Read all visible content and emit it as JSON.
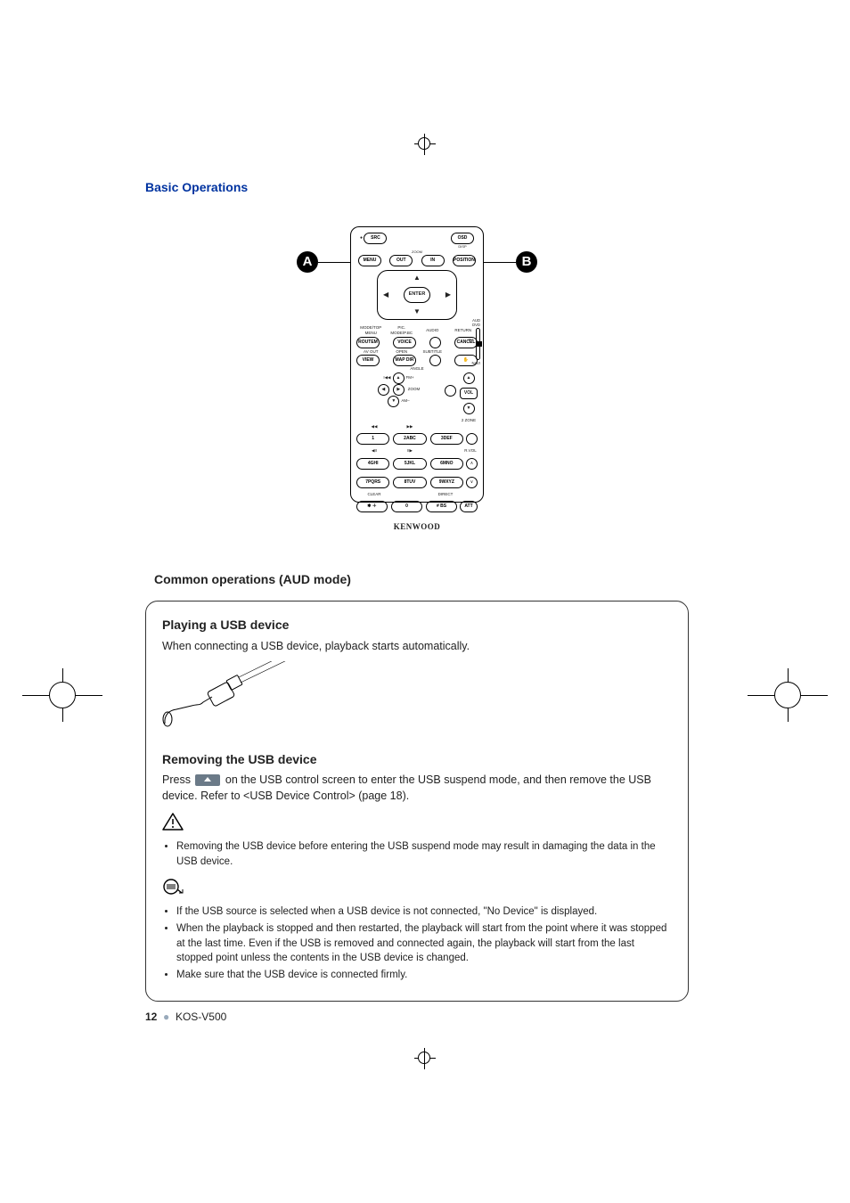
{
  "page": {
    "section_title": "Basic Operations",
    "subhead": "Common operations (AUD mode)",
    "page_number": "12",
    "model": "KOS-V500"
  },
  "callouts": {
    "A": "A",
    "B": "B"
  },
  "remote": {
    "top_labels": {
      "disp": "DISP",
      "ii_skip": "▶II"
    },
    "top_buttons": {
      "src": "SRC",
      "osd": "OSD"
    },
    "zoom_row_label": "ZOOM",
    "zoom_row": {
      "menu": "MENU",
      "out": "OUT",
      "in": "IN",
      "position": "POSITION"
    },
    "menu_dot": "●",
    "dpad": {
      "enter": "ENTER",
      "up": "▲",
      "down": "▼",
      "left": "◀",
      "right": "▶"
    },
    "mode_switch": {
      "aud": "AUD",
      "dvd": "DVD",
      "tv": "TV",
      "navi": "NAVI"
    },
    "mid_labels": {
      "mode_top": "MODE/TOP MENU",
      "pic": "PIC. MODE/P.BC",
      "audio": "AUDIO",
      "return": "RETURN",
      "avout": "AV OUT",
      "open": "OPEN",
      "subtitle": "SUBTITLE",
      "angle": "ANGLE"
    },
    "mid_buttons": {
      "routem": "ROUTEM",
      "voice": "VOICE",
      "audio_circ": "",
      "cancel": "CANCEL",
      "view": "VIEW",
      "mapdir": "MAP DIR",
      "sub_circ": "",
      "hand": "✋"
    },
    "tune": {
      "fm": "FM+",
      "am": "AM–",
      "left": "◀",
      "right": "▶",
      "up": "▲",
      "down": "▼",
      "prev": "I◀◀",
      "next": "▶▶I",
      "zoom": "ZOOM"
    },
    "vol": {
      "label": "VOL",
      "up": "▲",
      "down": "▼",
      "twozone": "2 ZONE"
    },
    "rvol": "R.VOL",
    "num": {
      "r1_sym": {
        "rew": "◀◀",
        "ff": "▶▶",
        "pause": "◀II",
        "play": "II▶"
      },
      "keys": [
        "1",
        "2ABC",
        "3DEF",
        "4GHI",
        "5JKL",
        "6MNO",
        "7PQRS",
        "8TUV",
        "9WXYZ",
        "0"
      ],
      "bottom_labels": {
        "clear": "CLEAR",
        "direct": "DIRECT"
      },
      "bottom": {
        "star": "✱ ＋",
        "hash": "# BS",
        "att": "ATT"
      }
    },
    "brand": "KENWOOD"
  },
  "card": {
    "h_play": "Playing a USB device",
    "p_play": "When connecting a USB device, playback starts automatically.",
    "h_remove": "Removing the USB device",
    "p_remove_pre": "Press",
    "p_remove_post": " on the USB control screen to enter the USB suspend mode, and then remove the USB device. Refer to <USB Device Control> (page 18).",
    "warn_bullet": "Removing the USB device before entering the USB suspend mode may result in damaging the data in the USB device.",
    "notes": [
      "If the USB source is selected when a USB device is not connected, \"No Device\" is displayed.",
      "When the playback is stopped and then restarted, the playback will start from the point where it was stopped at the last time. Even if the USB is removed and connected again, the playback will start from the last stopped point unless the contents in the USB device is changed.",
      "Make sure that the USB device is connected firmly."
    ]
  }
}
